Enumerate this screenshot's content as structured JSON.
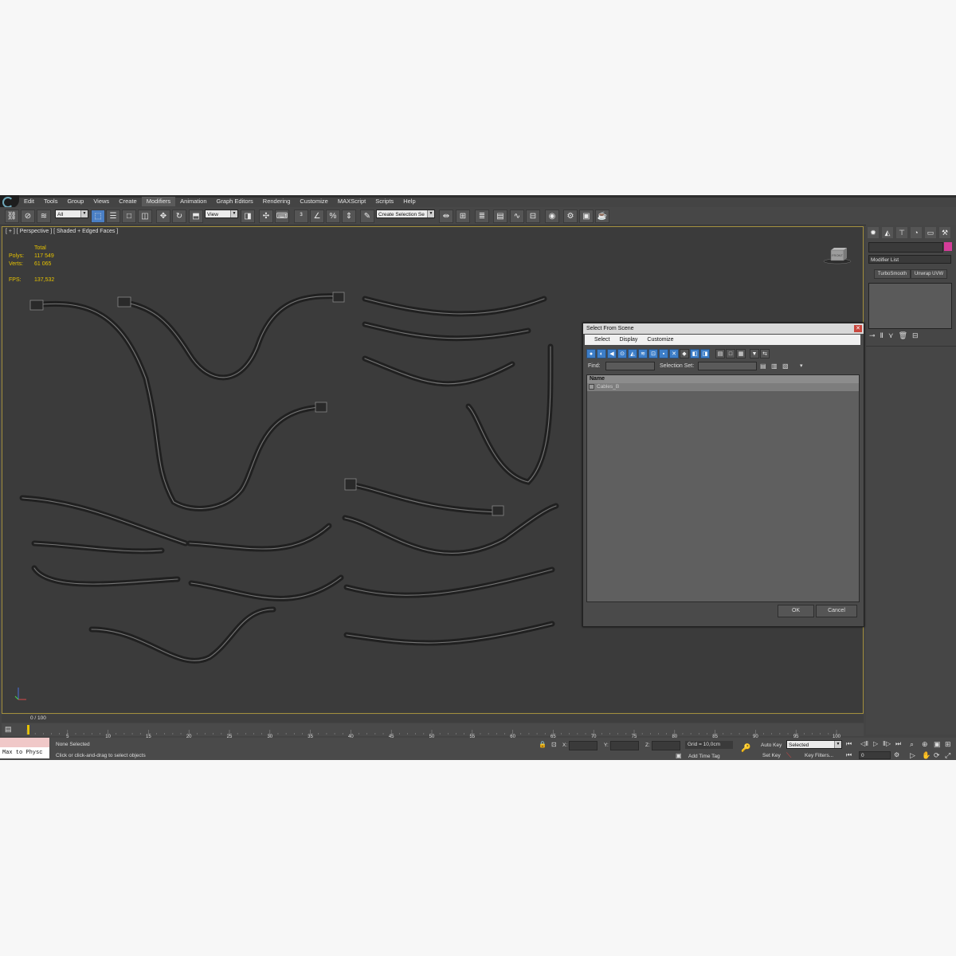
{
  "menu": [
    "Edit",
    "Tools",
    "Group",
    "Views",
    "Create",
    "Modifiers",
    "Animation",
    "Graph Editors",
    "Rendering",
    "Customize",
    "MAXScript",
    "Scripts",
    "Help"
  ],
  "menu_active_index": 5,
  "toolbar": {
    "filter_value": "All",
    "refcoord_value": "View",
    "selection_set_value": "Create Selection Se"
  },
  "viewport": {
    "label": "[ + ] [ Perspective ] [ Shaded + Edged Faces ]",
    "stats": {
      "total_label": "Total",
      "polys_label": "Polys:",
      "polys_value": "117 549",
      "verts_label": "Verts:",
      "verts_value": "61 065",
      "fps_label": "FPS:",
      "fps_value": "137,532"
    },
    "viewcube_label": "FRONT"
  },
  "command_panel": {
    "modifier_list": "Modifier List",
    "buttons": [
      "TurboSmooth",
      "Unwrap UVW"
    ],
    "color": "#d43c99"
  },
  "timeline": {
    "frame_label": "0 / 100",
    "ticks": [
      "5",
      "10",
      "15",
      "20",
      "25",
      "30",
      "35",
      "40",
      "45",
      "50",
      "55",
      "60",
      "65",
      "70",
      "75",
      "80",
      "85",
      "90",
      "95",
      "100"
    ]
  },
  "status": {
    "maxscript_text": "Max to Physc",
    "selection_status": "None Selected",
    "prompt": "Click or click-and-drag to select objects",
    "x_label": "X:",
    "y_label": "Y:",
    "z_label": "Z:",
    "grid": "Grid = 10,0cm",
    "add_time_tag": "Add Time Tag",
    "auto_key": "Auto Key",
    "set_key": "Set Key",
    "key_mode_value": "Selected",
    "key_filters": "Key Filters...",
    "frame_value": "0"
  },
  "dialog": {
    "title": "Select From Scene",
    "menu": [
      "Select",
      "Display",
      "Customize"
    ],
    "find_label": "Find:",
    "selection_set_label": "Selection Set:",
    "column_header": "Name",
    "items": [
      "Cables_B"
    ],
    "ok": "OK",
    "cancel": "Cancel"
  }
}
